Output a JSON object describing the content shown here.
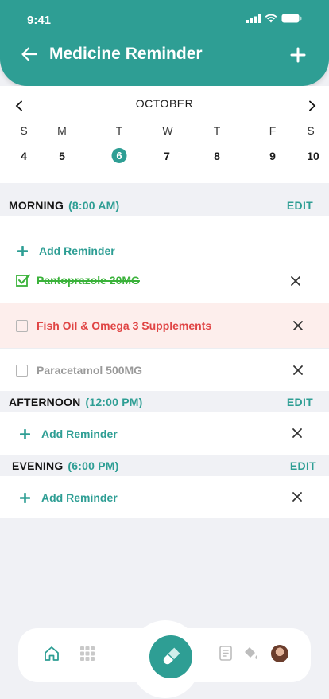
{
  "status_bar": {
    "time": "9:41"
  },
  "header": {
    "title": "Medicine Reminder"
  },
  "calendar": {
    "month": "OCTOBER",
    "weekdays": [
      "S",
      "M",
      "T",
      "W",
      "T",
      "F",
      "S"
    ],
    "days": [
      "4",
      "5",
      "6",
      "7",
      "8",
      "9",
      "10"
    ],
    "selected_day": "6"
  },
  "morning": {
    "title": "MORNING",
    "time": "(8:00 AM)",
    "edit_label": "EDIT",
    "add_label": "Add Reminder",
    "items": [
      {
        "name": "Pantoprazole 20MG",
        "state": "taken"
      },
      {
        "name": "Fish Oil & Omega 3 Supplements",
        "state": "missed"
      },
      {
        "name": "Paracetamol 500MG",
        "state": "pending"
      }
    ]
  },
  "afternoon": {
    "title": "AFTERNOON",
    "time": "(12:00 PM)",
    "edit_label": "EDIT",
    "add_label": "Add Reminder"
  },
  "evening": {
    "title": "EVENING",
    "time": "(6:00 PM)",
    "edit_label": "EDIT",
    "add_label": "Add Reminder"
  },
  "nav": {
    "icons": [
      "home-icon",
      "grid-icon",
      "pill-icon",
      "clipboard-icon",
      "paint-bucket-icon",
      "avatar"
    ],
    "active": "pill-icon"
  },
  "colors": {
    "accent": "#2e9e94",
    "taken": "#3ab23a",
    "missed": "#e04545",
    "missed_bg": "#fdeeec",
    "pending": "#9a9a9a",
    "background": "#f0f1f5"
  }
}
